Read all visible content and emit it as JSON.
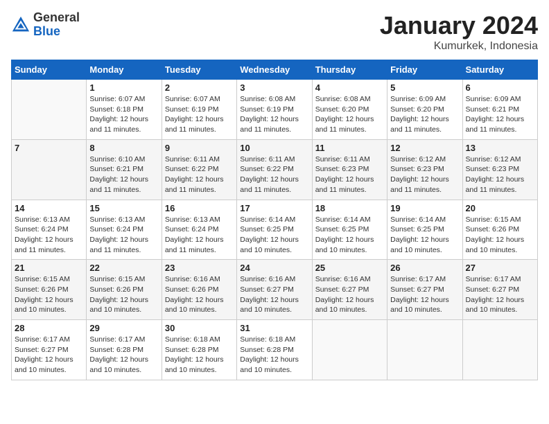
{
  "logo": {
    "general": "General",
    "blue": "Blue"
  },
  "title": "January 2024",
  "subtitle": "Kumurkek, Indonesia",
  "days_header": [
    "Sunday",
    "Monday",
    "Tuesday",
    "Wednesday",
    "Thursday",
    "Friday",
    "Saturday"
  ],
  "weeks": [
    [
      {
        "day": "",
        "info": ""
      },
      {
        "day": "1",
        "info": "Sunrise: 6:07 AM\nSunset: 6:18 PM\nDaylight: 12 hours\nand 11 minutes."
      },
      {
        "day": "2",
        "info": "Sunrise: 6:07 AM\nSunset: 6:19 PM\nDaylight: 12 hours\nand 11 minutes."
      },
      {
        "day": "3",
        "info": "Sunrise: 6:08 AM\nSunset: 6:19 PM\nDaylight: 12 hours\nand 11 minutes."
      },
      {
        "day": "4",
        "info": "Sunrise: 6:08 AM\nSunset: 6:20 PM\nDaylight: 12 hours\nand 11 minutes."
      },
      {
        "day": "5",
        "info": "Sunrise: 6:09 AM\nSunset: 6:20 PM\nDaylight: 12 hours\nand 11 minutes."
      },
      {
        "day": "6",
        "info": "Sunrise: 6:09 AM\nSunset: 6:21 PM\nDaylight: 12 hours\nand 11 minutes."
      }
    ],
    [
      {
        "day": "7",
        "info": ""
      },
      {
        "day": "8",
        "info": "Sunrise: 6:10 AM\nSunset: 6:21 PM\nDaylight: 12 hours\nand 11 minutes."
      },
      {
        "day": "9",
        "info": "Sunrise: 6:11 AM\nSunset: 6:22 PM\nDaylight: 12 hours\nand 11 minutes."
      },
      {
        "day": "10",
        "info": "Sunrise: 6:11 AM\nSunset: 6:22 PM\nDaylight: 12 hours\nand 11 minutes."
      },
      {
        "day": "11",
        "info": "Sunrise: 6:11 AM\nSunset: 6:23 PM\nDaylight: 12 hours\nand 11 minutes."
      },
      {
        "day": "12",
        "info": "Sunrise: 6:12 AM\nSunset: 6:23 PM\nDaylight: 12 hours\nand 11 minutes."
      },
      {
        "day": "13",
        "info": "Sunrise: 6:12 AM\nSunset: 6:23 PM\nDaylight: 12 hours\nand 11 minutes."
      }
    ],
    [
      {
        "day": "14",
        "info": "Sunrise: 6:13 AM\nSunset: 6:24 PM\nDaylight: 12 hours\nand 11 minutes."
      },
      {
        "day": "15",
        "info": "Sunrise: 6:13 AM\nSunset: 6:24 PM\nDaylight: 12 hours\nand 11 minutes."
      },
      {
        "day": "16",
        "info": "Sunrise: 6:13 AM\nSunset: 6:24 PM\nDaylight: 12 hours\nand 11 minutes."
      },
      {
        "day": "17",
        "info": "Sunrise: 6:14 AM\nSunset: 6:25 PM\nDaylight: 12 hours\nand 10 minutes."
      },
      {
        "day": "18",
        "info": "Sunrise: 6:14 AM\nSunset: 6:25 PM\nDaylight: 12 hours\nand 10 minutes."
      },
      {
        "day": "19",
        "info": "Sunrise: 6:14 AM\nSunset: 6:25 PM\nDaylight: 12 hours\nand 10 minutes."
      },
      {
        "day": "20",
        "info": "Sunrise: 6:15 AM\nSunset: 6:26 PM\nDaylight: 12 hours\nand 10 minutes."
      }
    ],
    [
      {
        "day": "21",
        "info": "Sunrise: 6:15 AM\nSunset: 6:26 PM\nDaylight: 12 hours\nand 10 minutes."
      },
      {
        "day": "22",
        "info": "Sunrise: 6:15 AM\nSunset: 6:26 PM\nDaylight: 12 hours\nand 10 minutes."
      },
      {
        "day": "23",
        "info": "Sunrise: 6:16 AM\nSunset: 6:26 PM\nDaylight: 12 hours\nand 10 minutes."
      },
      {
        "day": "24",
        "info": "Sunrise: 6:16 AM\nSunset: 6:27 PM\nDaylight: 12 hours\nand 10 minutes."
      },
      {
        "day": "25",
        "info": "Sunrise: 6:16 AM\nSunset: 6:27 PM\nDaylight: 12 hours\nand 10 minutes."
      },
      {
        "day": "26",
        "info": "Sunrise: 6:17 AM\nSunset: 6:27 PM\nDaylight: 12 hours\nand 10 minutes."
      },
      {
        "day": "27",
        "info": "Sunrise: 6:17 AM\nSunset: 6:27 PM\nDaylight: 12 hours\nand 10 minutes."
      }
    ],
    [
      {
        "day": "28",
        "info": "Sunrise: 6:17 AM\nSunset: 6:27 PM\nDaylight: 12 hours\nand 10 minutes."
      },
      {
        "day": "29",
        "info": "Sunrise: 6:17 AM\nSunset: 6:28 PM\nDaylight: 12 hours\nand 10 minutes."
      },
      {
        "day": "30",
        "info": "Sunrise: 6:18 AM\nSunset: 6:28 PM\nDaylight: 12 hours\nand 10 minutes."
      },
      {
        "day": "31",
        "info": "Sunrise: 6:18 AM\nSunset: 6:28 PM\nDaylight: 12 hours\nand 10 minutes."
      },
      {
        "day": "",
        "info": ""
      },
      {
        "day": "",
        "info": ""
      },
      {
        "day": "",
        "info": ""
      }
    ]
  ]
}
